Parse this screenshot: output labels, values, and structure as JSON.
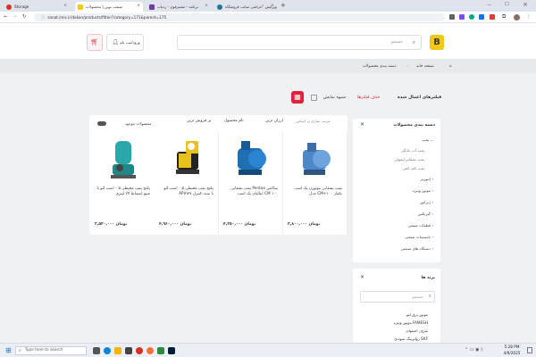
{
  "browser": {
    "tabs": [
      {
        "label": "Storage",
        "color": "#d93025"
      },
      {
        "label": "صنعت نوین | محصولات",
        "color": "#f2c811"
      },
      {
        "label": "برنامه - مشترفون - ردیاب",
        "color": "#6b3fa0"
      },
      {
        "label": "ویرایش \"خراشی سانت فروشگاه",
        "color": "#21759b"
      }
    ],
    "new_tab": "+",
    "url": "sanat.imis.ir/dokan/products/filter/?category=171&parent=175"
  },
  "header": {
    "logo_letter": "B",
    "search_placeholder": "جستجو",
    "login_label": "ورود/ثبت نام",
    "cart_icon": "cart-icon"
  },
  "breadcrumb": {
    "home": "صفحه خانه",
    "current": "دسته بندی محصولات"
  },
  "filters_bar": {
    "applied_title": "فیلترهای اعمال شده",
    "remove_filters": "حذف فیلترها",
    "display_mode": "شیوه نمایش"
  },
  "sort_bar": {
    "sort_label": "مرتب سازی بر اساس",
    "options": [
      "ارزان ترین",
      "نام محصول",
      "پر فروش ترین"
    ],
    "available_label": "محصولات موجود"
  },
  "products": [
    {
      "name": "پمپ بشقابی موتوژن یک اسب مدل CM+۱۰۰ تکفاز",
      "price": "۳,۸۰۰,۰۰۰ تومان",
      "color": "#4d87c7"
    },
    {
      "name": "پمپ بشقابی Pentax پنتاکس ایتالیای یک اسب CM ۱۰۰",
      "price": "۴,۳۵۰,۰۰۰ تومان",
      "color": "#1f6fb5"
    },
    {
      "name": "پکیج پمپ محیطی ۰.۵ اسب لئو APm۳۷ با ست کنترل",
      "price": "۴,۹۶۰,۰۰۰ تومان",
      "color": "#e8c21c"
    },
    {
      "name": "پکیج پمپ محیطی ۰.۵ اسب لئو با منبع انبساط ۲۴ لیتری",
      "price": "۳,۵۲۰,۰۰۰ تومان",
      "color": "#2aa7a8"
    }
  ],
  "categories": {
    "title": "دسته بندی محصولات",
    "items": [
      {
        "label": "پمپ",
        "expanded": true
      },
      {
        "label": "پمپ آب خانگی",
        "sub": true
      },
      {
        "label": "پمپ بشقابی/بقولی",
        "sub": true
      },
      {
        "label": "پمپ کف کش",
        "sub": true
      },
      {
        "label": "اینورتر",
        "expanded": false
      },
      {
        "label": "موتور ویبره",
        "expanded": false
      },
      {
        "label": "ژنراتور",
        "expanded": false
      },
      {
        "label": "گیربکس",
        "expanded": false
      },
      {
        "label": "قطعات صنعتی",
        "expanded": false
      },
      {
        "label": "تاسیسات صنعتی",
        "expanded": false
      },
      {
        "label": "دستگاه های صنعتی",
        "expanded": false
      }
    ]
  },
  "brands": {
    "title": "برند ها",
    "search_placeholder": "جستجو",
    "items": [
      "موتور برق لئو",
      "موتور ویبره FAMESH",
      "شرف اصفهان",
      "رولبرینگ سوئدی SKF"
    ]
  },
  "taskbar": {
    "search_placeholder": "Type here to search",
    "time": "5:28 PM",
    "date": "4/9/2025"
  }
}
